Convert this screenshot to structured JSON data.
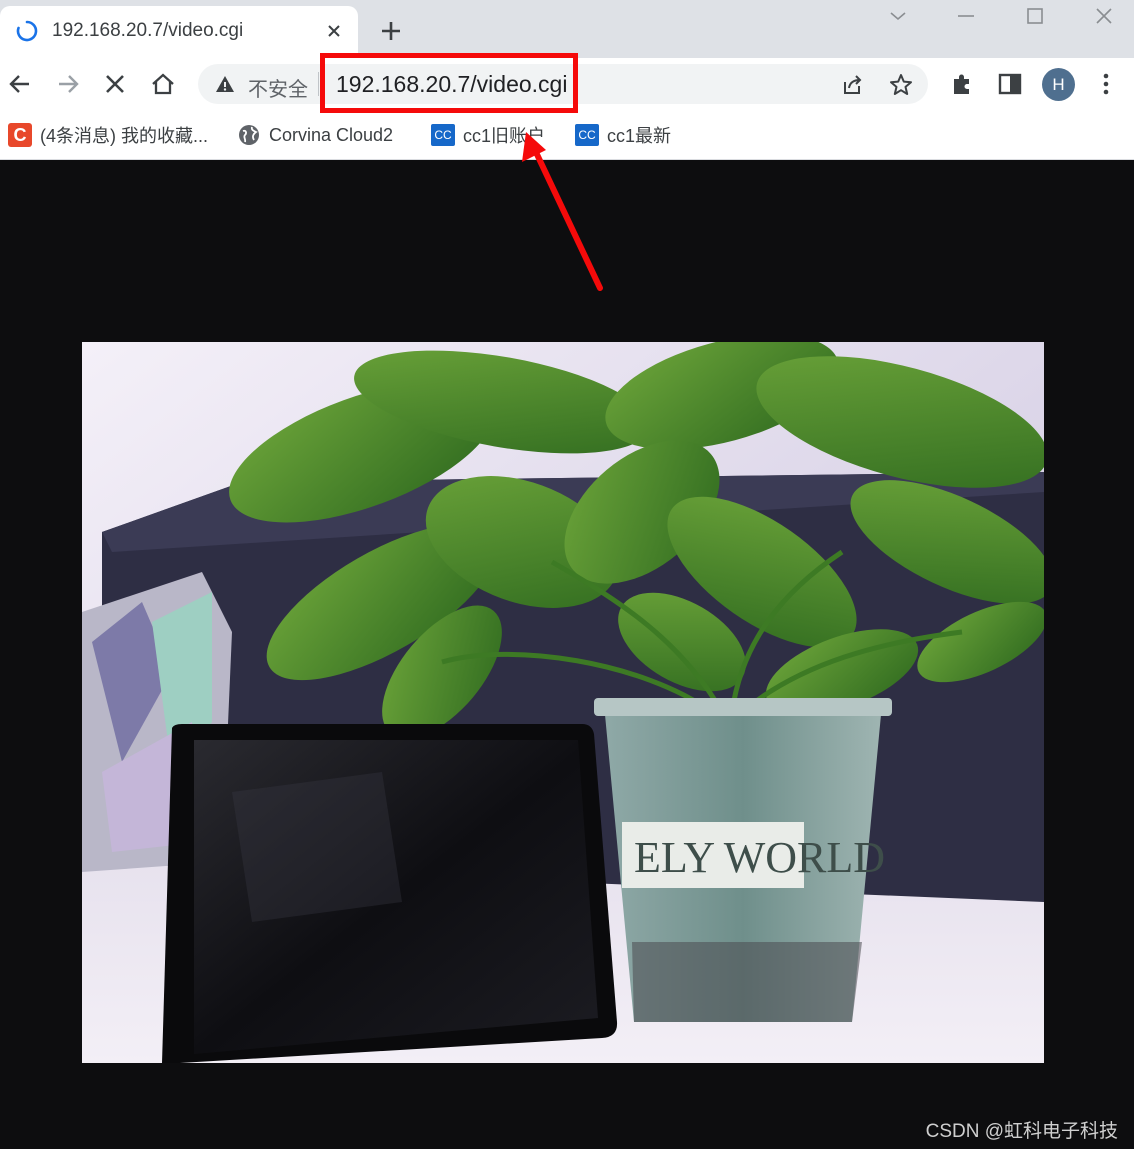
{
  "tab": {
    "title": "192.168.20.7/video.cgi"
  },
  "toolbar": {
    "security_label": "不安全",
    "url": "192.168.20.7/video.cgi",
    "avatar_letter": "H"
  },
  "bookmarks": [
    {
      "label": "(4条消息) 我的收藏...",
      "icon": "csdn-favicon"
    },
    {
      "label": "Corvina Cloud2",
      "icon": "globe-icon"
    },
    {
      "label": "cc1旧账户",
      "icon": "cc-favicon"
    },
    {
      "label": "cc1最新",
      "icon": "cc-favicon"
    }
  ],
  "bookmark_favicons": {
    "csdn": "C",
    "cc": "CC"
  },
  "video": {
    "pot_label": "ELY WORLD"
  },
  "watermark": "CSDN @虹科电子科技",
  "colors": {
    "highlight": "#f50a0a",
    "tab_strip": "#dee1e6",
    "omnibox": "#f1f3f4",
    "page_background": "#0d0d0f"
  }
}
